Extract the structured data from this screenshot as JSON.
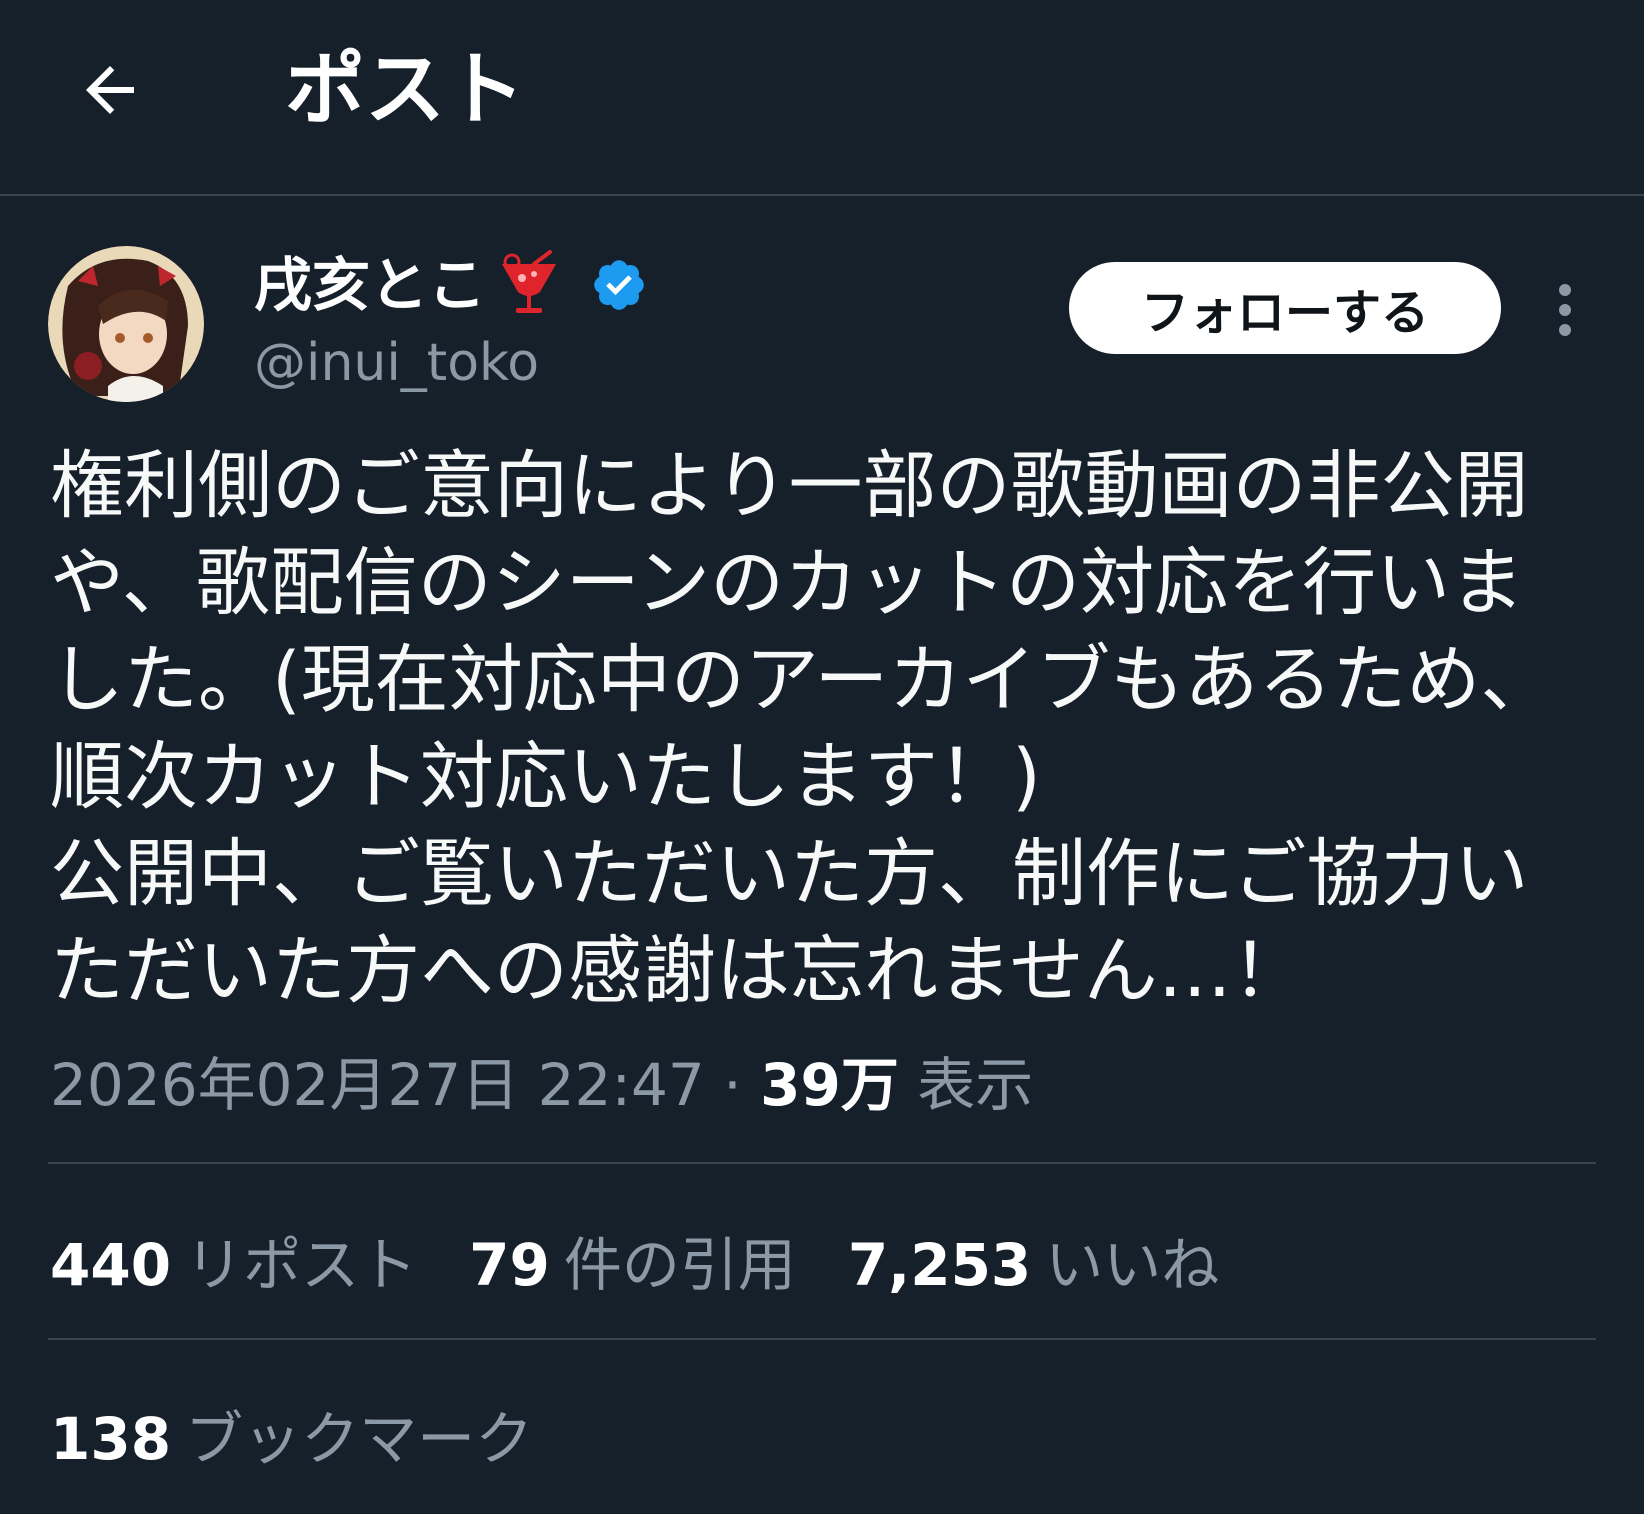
{
  "header": {
    "title": "ポスト",
    "back_icon": "arrow-left-icon"
  },
  "author": {
    "display_name": "戌亥とこ",
    "name_emoji": "cocktail-emoji",
    "verified_icon": "verified-badge-icon",
    "handle": "@inui_toko",
    "follow_label": "フォローする",
    "more_icon": "more-vertical-icon"
  },
  "post": {
    "lines": [
      "権利側のご意向により一部の歌動画の非公開",
      "や、歌配信のシーンのカットの対応を行いま",
      "した。(現在対応中のアーカイブもあるため、",
      "順次カット対応いたします！)",
      "公開中、ご覧いただいた方、制作にご協力い",
      "ただいた方への感謝は忘れません…！"
    ],
    "timestamp": "2026年02月27日 22:47",
    "separator": " · ",
    "views_count": "39万",
    "views_label": "表示"
  },
  "stats": {
    "reposts_count": "440",
    "reposts_label": "リポスト",
    "quotes_count": "79",
    "quotes_label": "件の引用",
    "likes_count": "7,253",
    "likes_label": "いいね",
    "bookmarks_count": "138",
    "bookmarks_label": "ブックマーク"
  },
  "colors": {
    "background": "#15202b",
    "divider": "#38444d",
    "secondary_text": "#8b98a5",
    "verified_blue": "#1d9bf0"
  }
}
